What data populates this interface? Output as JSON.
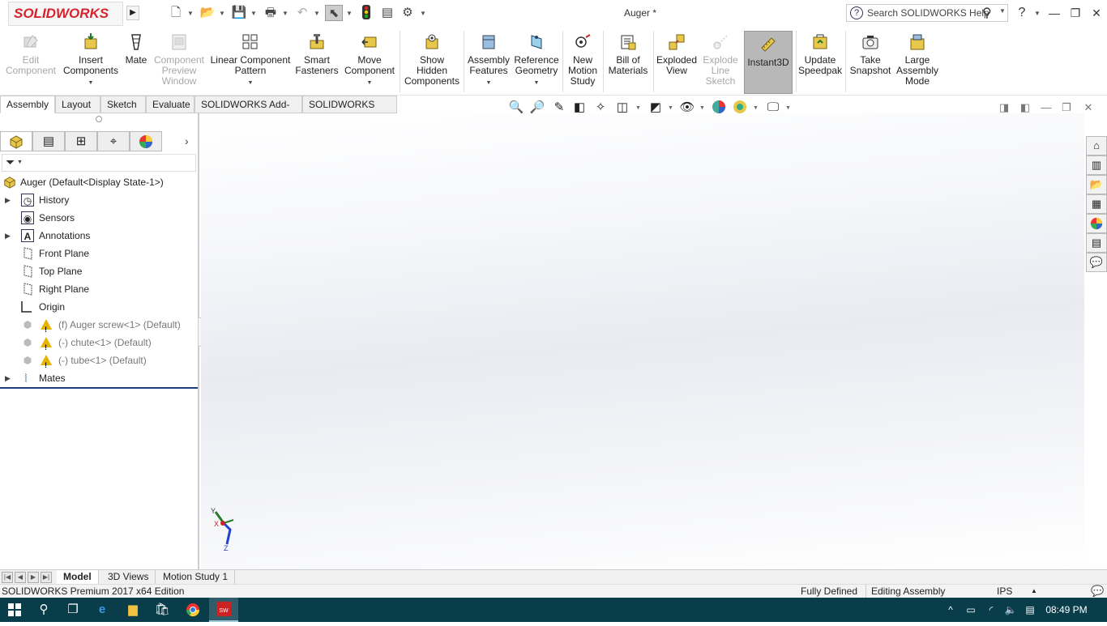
{
  "app": {
    "logo_text": "SOLIDWORKS",
    "document_title": "Auger *",
    "search_placeholder": "Search SOLIDWORKS Help"
  },
  "quick_access": [
    {
      "name": "new-document-icon",
      "glyph": "🗋"
    },
    {
      "name": "open-document-icon",
      "glyph": "📂"
    },
    {
      "name": "save-icon",
      "glyph": "💾"
    },
    {
      "name": "print-icon",
      "glyph": "🖶"
    },
    {
      "name": "undo-icon",
      "glyph": "↶"
    },
    {
      "name": "select-icon",
      "glyph": "⬉"
    },
    {
      "name": "rebuild-icon",
      "glyph": "🚦"
    },
    {
      "name": "file-properties-icon",
      "glyph": "▤"
    },
    {
      "name": "options-icon",
      "glyph": "⚙"
    }
  ],
  "ribbon": {
    "edit_component": "Edit\nComponent",
    "insert_components": "Insert\nComponents",
    "mate": "Mate",
    "component_preview_window": "Component\nPreview\nWindow",
    "linear_component_pattern": "Linear Component\nPattern",
    "smart_fasteners": "Smart\nFasteners",
    "move_component": "Move\nComponent",
    "show_hidden_components": "Show\nHidden\nComponents",
    "assembly_features": "Assembly\nFeatures",
    "reference_geometry": "Reference\nGeometry",
    "new_motion_study": "New\nMotion\nStudy",
    "bill_of_materials": "Bill of\nMaterials",
    "exploded_view": "Exploded\nView",
    "explode_line_sketch": "Explode\nLine\nSketch",
    "instant3d": "Instant3D",
    "update_speedpak": "Update\nSpeedpak",
    "take_snapshot": "Take\nSnapshot",
    "large_assembly_mode": "Large\nAssembly\nMode"
  },
  "command_tabs": [
    "Assembly",
    "Layout",
    "Sketch",
    "Evaluate",
    "SOLIDWORKS Add-Ins",
    "SOLIDWORKS MBD"
  ],
  "feature_tree": {
    "root": "Auger  (Default<Display State-1>)",
    "items": [
      {
        "label": "History",
        "expandable": true,
        "grey": false
      },
      {
        "label": "Sensors",
        "expandable": false,
        "grey": false
      },
      {
        "label": "Annotations",
        "expandable": true,
        "grey": false
      },
      {
        "label": "Front Plane",
        "expandable": false,
        "grey": false
      },
      {
        "label": "Top Plane",
        "expandable": false,
        "grey": false
      },
      {
        "label": "Right Plane",
        "expandable": false,
        "grey": false
      },
      {
        "label": "Origin",
        "expandable": false,
        "grey": false
      },
      {
        "label": "(f) Auger screw<1> (Default)",
        "expandable": false,
        "grey": true
      },
      {
        "label": "(-) chute<1> (Default)",
        "expandable": false,
        "grey": true
      },
      {
        "label": "(-) tube<1> (Default)",
        "expandable": false,
        "grey": true
      },
      {
        "label": "Mates",
        "expandable": true,
        "grey": false
      }
    ]
  },
  "triad": {
    "x": "X",
    "y": "Y",
    "z": "Z"
  },
  "bottom_tabs": [
    "Model",
    "3D Views",
    "Motion Study 1"
  ],
  "status_bar": {
    "edition": "SOLIDWORKS Premium 2017 x64 Edition",
    "definition": "Fully Defined",
    "mode": "Editing Assembly",
    "units": "IPS"
  },
  "taskbar": {
    "time": "08:49 PM"
  }
}
